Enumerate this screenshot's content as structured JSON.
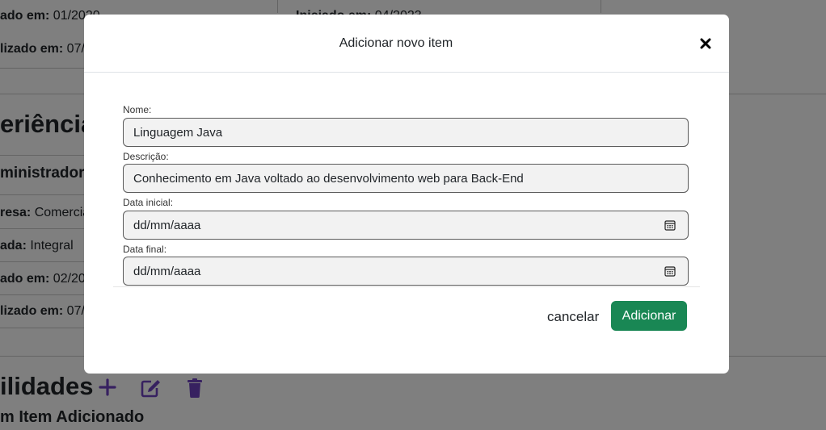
{
  "background": {
    "left_card": {
      "row1": {
        "label": "ado em:",
        "value": " 01/2020"
      },
      "row2": {
        "label": "lizado em:",
        "value": " 07/"
      }
    },
    "right_card": {
      "row1": {
        "label": "Iniciado em:",
        "value": " 04/2023"
      }
    },
    "experience": {
      "heading": "eriência",
      "job_title": "ministrador d",
      "row1": {
        "label": "resa:",
        "value": " Comercia"
      },
      "row2": {
        "label": "ada:",
        "value": " Integral"
      },
      "row3": {
        "label": "ado em:",
        "value": " 02/20"
      },
      "row4": {
        "label": "lizado em:",
        "value": " 07/"
      }
    },
    "skills": {
      "heading": "ilidades",
      "empty_text": "m Item Adicionado"
    },
    "accent_color": "#6f42c1"
  },
  "modal": {
    "title": "Adicionar novo item",
    "fields": {
      "name": {
        "label": "Nome:",
        "value": "Linguagem Java"
      },
      "description": {
        "label": "Descrição:",
        "value": "Conhecimento em Java voltado ao desenvolvimento web para Back-End"
      },
      "start_date": {
        "label": "Data inicial:",
        "value": "dd/mm/aaaa"
      },
      "end_date": {
        "label": "Data final:",
        "value": "dd/mm/aaaa"
      }
    },
    "cancel_label": "cancelar",
    "submit_label": "Adicionar",
    "submit_color": "#198754"
  }
}
